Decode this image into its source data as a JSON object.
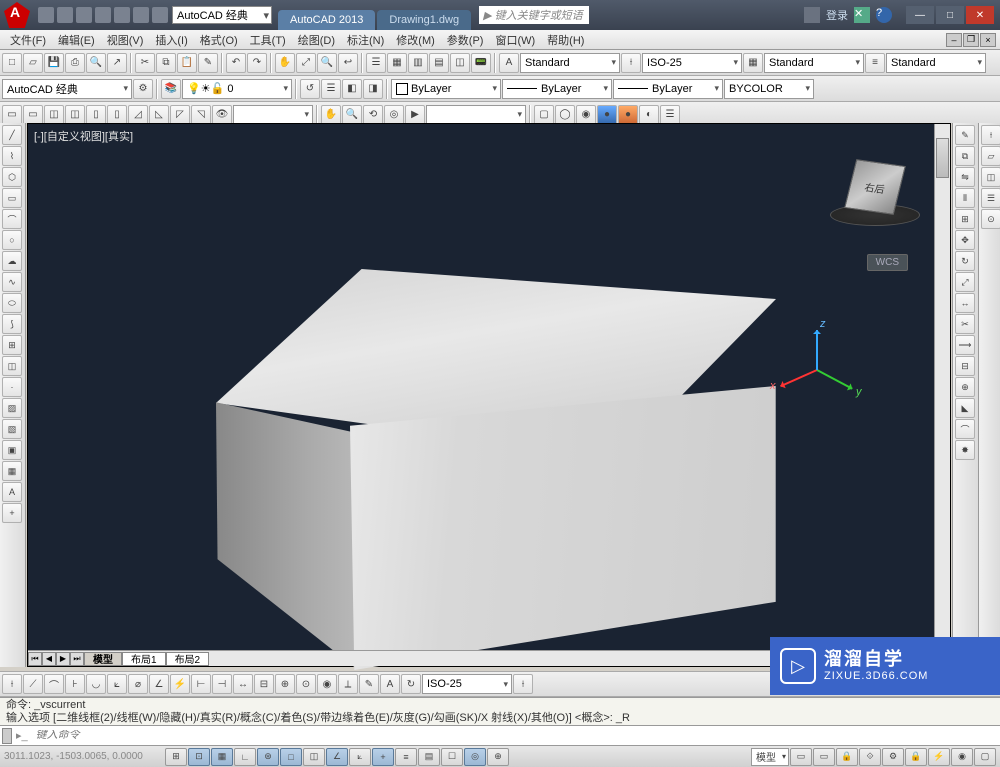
{
  "title": {
    "workspace": "AutoCAD 经典",
    "app": "AutoCAD 2013",
    "doc": "Drawing1.dwg",
    "search_placeholder": "键入关键字或短语",
    "login": "登录"
  },
  "menu": {
    "items": [
      "文件(F)",
      "编辑(E)",
      "视图(V)",
      "插入(I)",
      "格式(O)",
      "工具(T)",
      "绘图(D)",
      "标注(N)",
      "修改(M)",
      "参数(P)",
      "窗口(W)",
      "帮助(H)"
    ]
  },
  "styles": {
    "text_style": "Standard",
    "dim_style": "ISO-25",
    "table_style": "Standard",
    "ml_style": "Standard"
  },
  "layers": {
    "workspace_dd": "AutoCAD 经典",
    "layer_dd": "0",
    "color_dd": "ByLayer",
    "linetype_dd": "ByLayer",
    "lineweight_dd": "ByLayer",
    "plotstyle_dd": "BYCOLOR"
  },
  "viewport": {
    "label": "[-][自定义视图][真实]",
    "viewcube_face": "右后",
    "wcs": "WCS",
    "axes": {
      "x": "x",
      "y": "y",
      "z": "z"
    }
  },
  "layout_tabs": [
    "模型",
    "布局1",
    "布局2"
  ],
  "dim_dd": "ISO-25",
  "command": {
    "line1": "命令: _vscurrent",
    "line2": "输入选项 [二维线框(2)/线框(W)/隐藏(H)/真实(R)/概念(C)/着色(S)/带边缘着色(E)/灰度(G)/勾画(SK)/X 射线(X)/其他(O)] <概念>: _R",
    "prompt_placeholder": "键入命令"
  },
  "status": {
    "coords": "3011.1023, -1503.0065, 0.0000",
    "model_btn": "模型"
  },
  "watermark": {
    "ch": "溜溜自学",
    "url": "ZIXUE.3D66.COM",
    "play": "▷"
  }
}
